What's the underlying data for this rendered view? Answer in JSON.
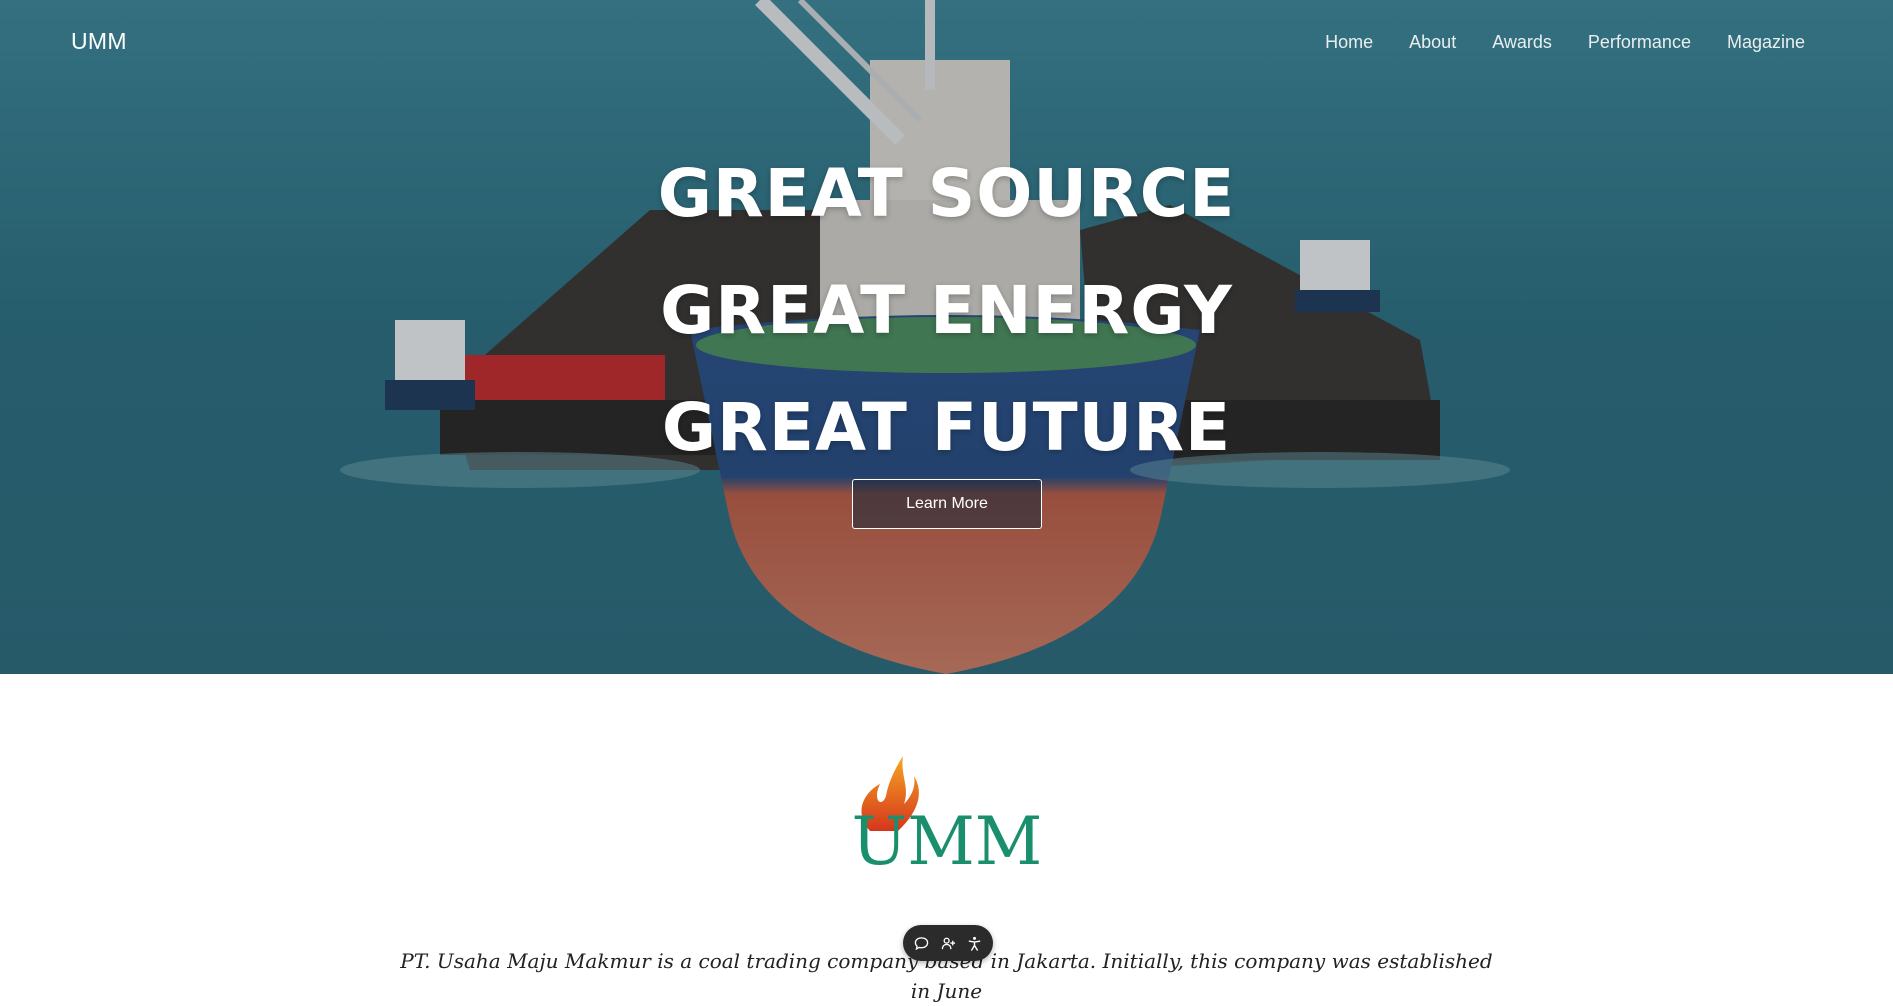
{
  "nav": {
    "brand": "UMM",
    "links": [
      {
        "label": "Home"
      },
      {
        "label": "About"
      },
      {
        "label": "Awards"
      },
      {
        "label": "Performance"
      },
      {
        "label": "Magazine"
      }
    ]
  },
  "hero": {
    "lines": [
      "GREAT SOURCE",
      "GREAT ENERGY",
      "GREAT FUTURE"
    ],
    "cta_label": "Learn More"
  },
  "logo": {
    "text": "UMM",
    "colors": {
      "flame_top": "#f39c1f",
      "flame_bottom": "#d9381e",
      "letters": "#1a8f6e"
    }
  },
  "about": {
    "text": "PT. Usaha Maju Makmur is a coal trading company based in Jakarta. Initially, this company was established in June"
  },
  "toolbar": {
    "icons": [
      "chat-icon",
      "add-user-icon",
      "accessibility-icon"
    ]
  }
}
